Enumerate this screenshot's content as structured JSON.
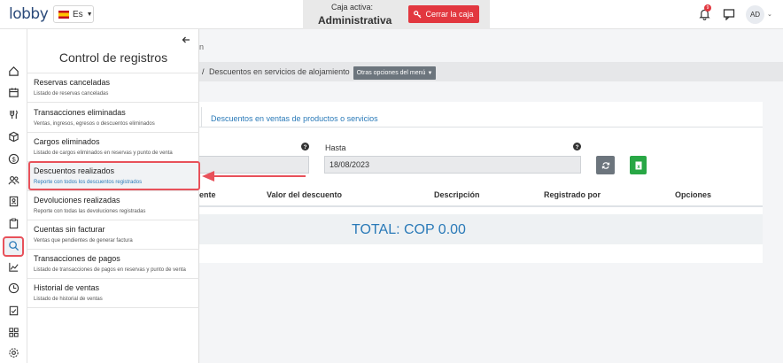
{
  "app": {
    "logo": "lobby"
  },
  "header": {
    "language": "Es",
    "caja_label": "Caja activa:",
    "caja_name": "Administrativa",
    "close_button": "Cerrar la caja",
    "notifications_count": "9",
    "user_initials": "AD"
  },
  "panel": {
    "title": "Control de registros",
    "items": [
      {
        "title": "Reservas canceladas",
        "desc": "Listado de reservas canceladas"
      },
      {
        "title": "Transacciones eliminadas",
        "desc": "Ventas, ingresos, egresos o descuentos eliminados"
      },
      {
        "title": "Cargos eliminados",
        "desc": "Listado de cargos eliminados en reservas y punto de venta"
      },
      {
        "title": "Descuentos realizados",
        "desc": "Reporte con todos los descuentos registrados"
      },
      {
        "title": "Devoluciones realizadas",
        "desc": "Reporte con todas las devoluciones registradas"
      },
      {
        "title": "Cuentas sin facturar",
        "desc": "Ventas que pendientes de generar factura"
      },
      {
        "title": "Transacciones de pagos",
        "desc": "Listado de transacciones de pagos en reservas y punto de venta"
      },
      {
        "title": "Historial de ventas",
        "desc": "Listado de historial de ventas"
      }
    ]
  },
  "main": {
    "title_fragment": "n",
    "breadcrumb_sep": "/",
    "breadcrumb": "Descuentos en servicios de alojamiento",
    "more_options": "Otras opciones del menú",
    "tab": "Descuentos en ventas de productos o servicios",
    "hasta_label": "Hasta",
    "hasta_value": "18/08/2023",
    "columns": [
      "ente",
      "Valor del descuento",
      "Descripción",
      "Registrado por",
      "Opciones"
    ],
    "total": "TOTAL: COP 0.00"
  },
  "colors": {
    "accent": "#2a7ab8",
    "danger": "#e2373f",
    "success": "#28a745",
    "highlight": "#e8515a"
  },
  "rail_icons": [
    "home-icon",
    "calendar-icon",
    "fork-knife-icon",
    "box-icon",
    "dollar-icon",
    "users-icon",
    "contact-card-icon",
    "clipboard-icon",
    "search-icon",
    "chart-line-icon",
    "clock-icon",
    "clipboard-check-icon",
    "apps-grid-icon",
    "settings-icon"
  ]
}
